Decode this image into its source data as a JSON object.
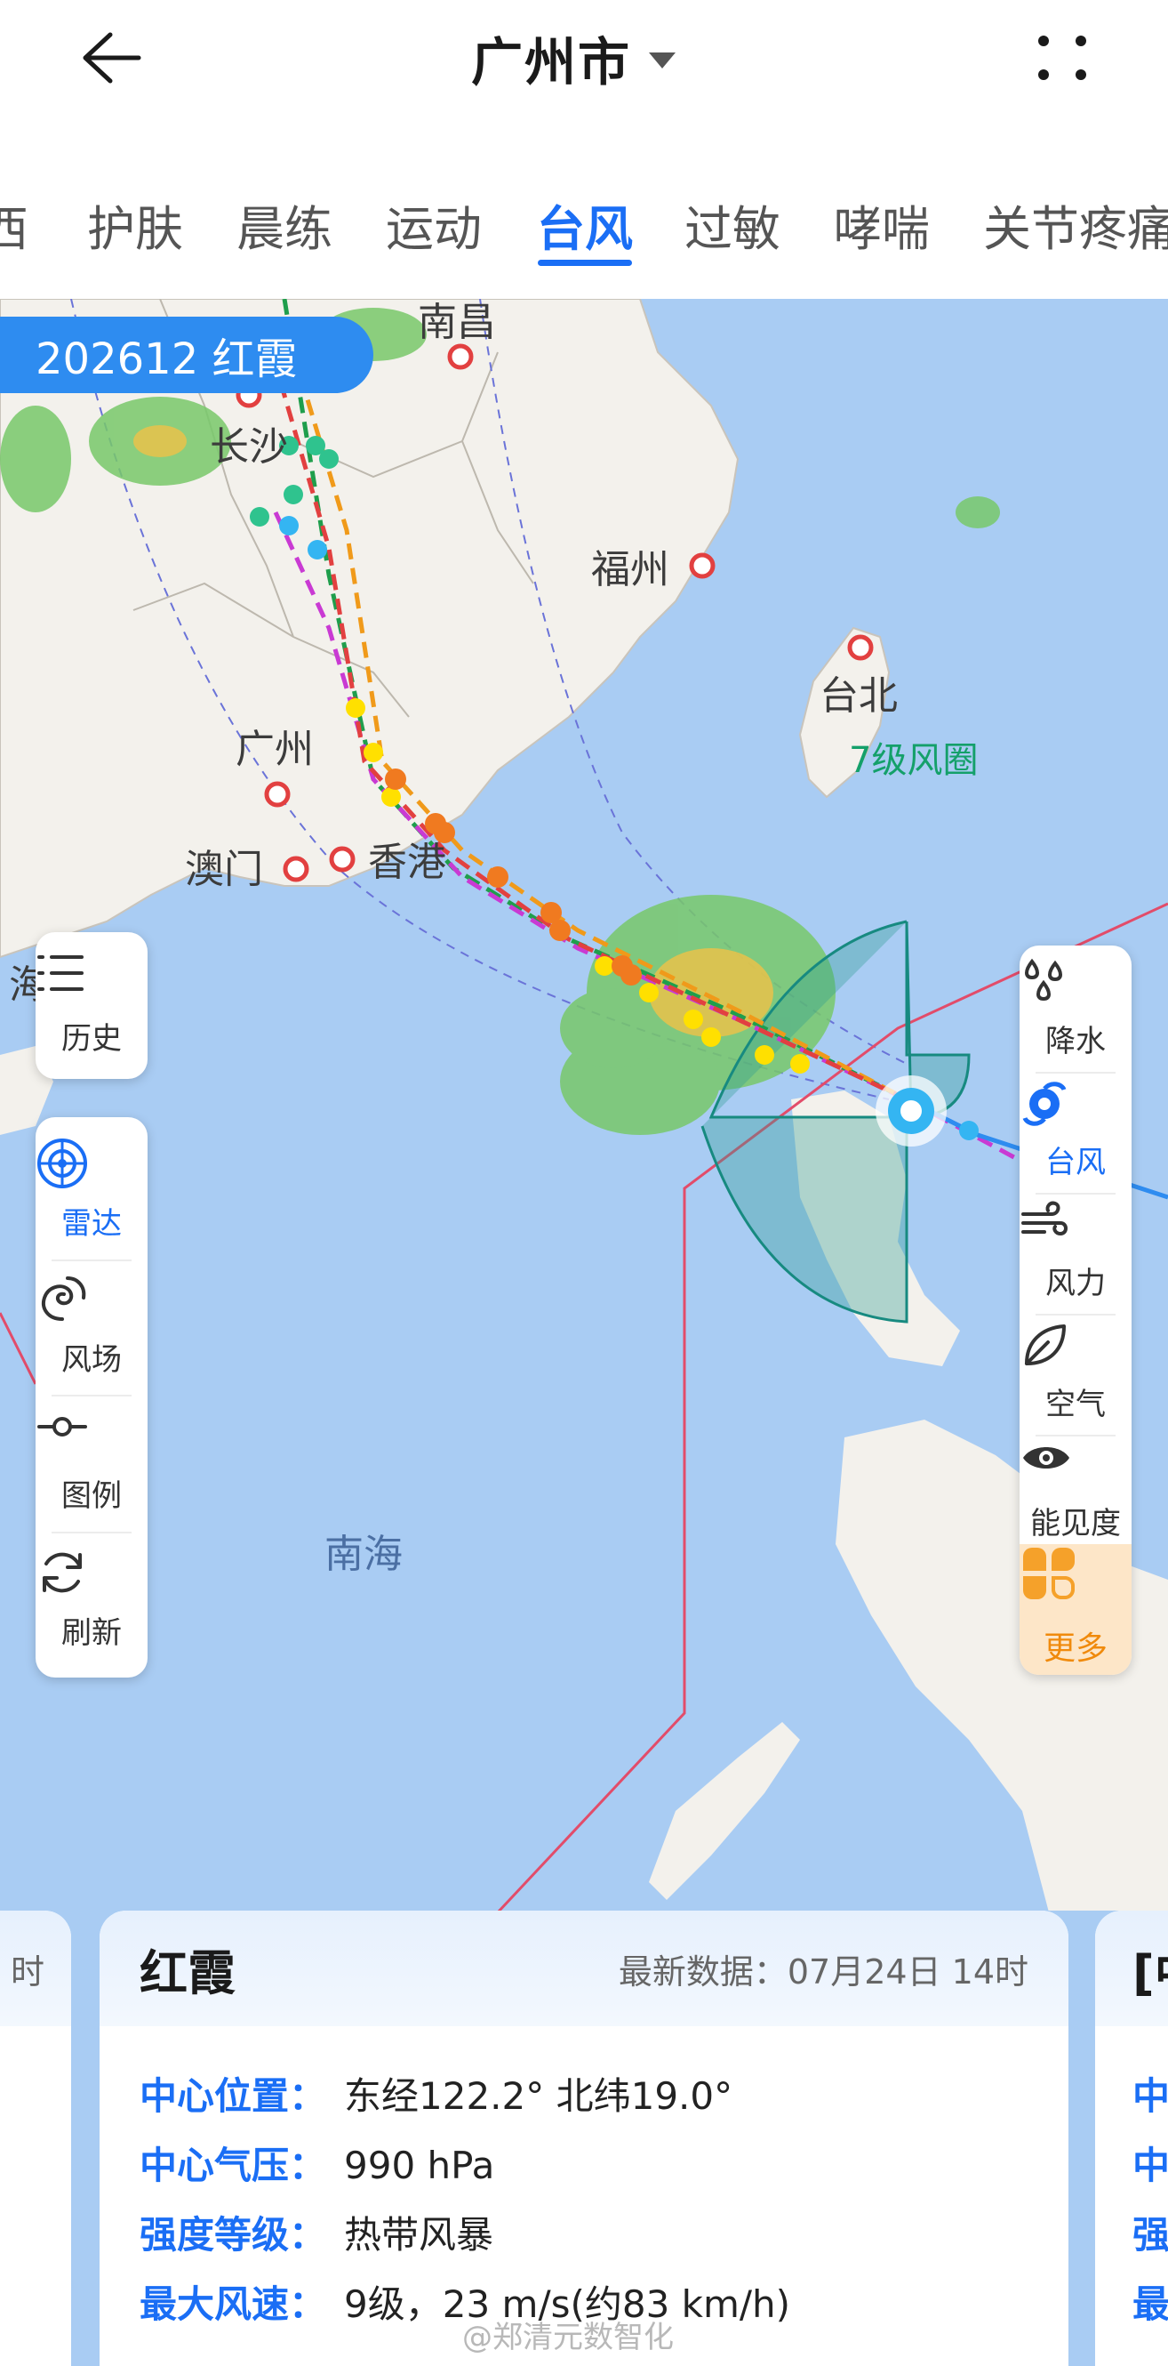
{
  "header": {
    "city": "广州市"
  },
  "tabs": [
    "西",
    "护肤",
    "晨练",
    "运动",
    "台风",
    "过敏",
    "哮喘",
    "关节疼痛"
  ],
  "active_tab": "台风",
  "typhoon_badge": "202612 红霞",
  "map_labels": {
    "nanchang": "南昌",
    "changsha": "长沙",
    "fuzhou": "福州",
    "taipei": "台北",
    "guangzhou": "广州",
    "macau": "澳门",
    "hongkong": "香港",
    "south_sea": "南海",
    "wind_circle": "7级风圈",
    "left_edge": "海"
  },
  "left_tools": {
    "history": "历史",
    "radar": "雷达",
    "wind_field": "风场",
    "legend": "图例",
    "refresh": "刷新"
  },
  "right_tools": {
    "rain": "降水",
    "typhoon": "台风",
    "wind": "风力",
    "air": "空气",
    "visibility": "能见度",
    "more": "更多"
  },
  "card": {
    "name": "红霞",
    "latest": "最新数据：07月24日 14时",
    "rows": [
      {
        "key": "中心位置：",
        "value": "东经122.2° 北纬19.0°"
      },
      {
        "key": "中心气压：",
        "value": "990 hPa"
      },
      {
        "key": "强度等级：",
        "value": "热带风暴"
      },
      {
        "key": "最大风速：",
        "value": "9级，23 m/s(约83 km/h)"
      }
    ],
    "left_partial": "时",
    "right_partial": "[中",
    "right_partial_rows": [
      "中",
      "中",
      "强",
      "最"
    ]
  },
  "watermark": "@郑清元数智化",
  "colors": {
    "accent": "#1a6ef5",
    "sea": "#a9ccf3",
    "land": "#f5f3ee",
    "more_bg": "#fde6c8",
    "more_fg": "#f08a0c"
  }
}
